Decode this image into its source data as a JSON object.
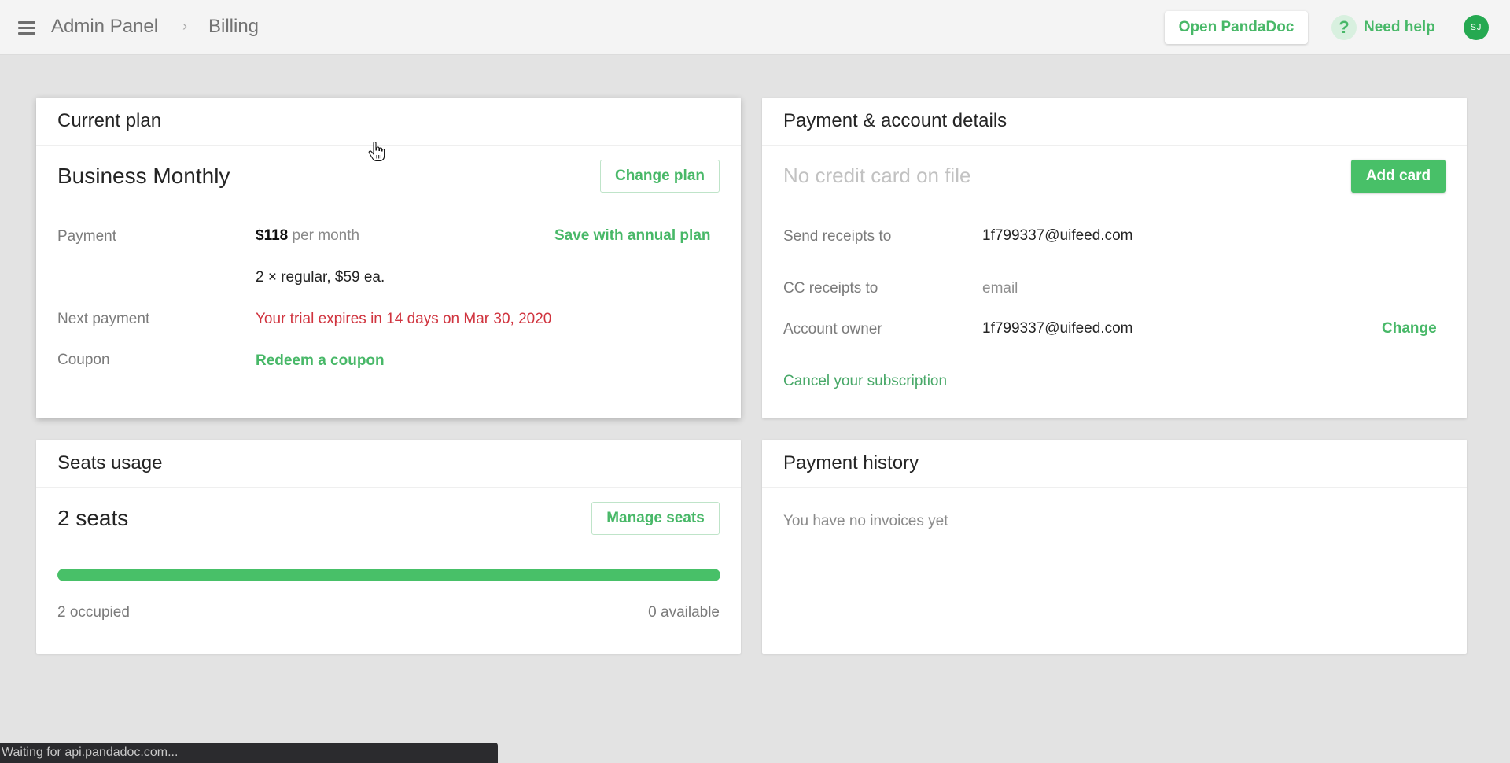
{
  "header": {
    "menu_icon": "hamburger-menu-icon",
    "breadcrumb": [
      "Admin Panel",
      "Billing"
    ],
    "breadcrumb_separator": "›",
    "open_app_label": "Open PandaDoc",
    "help_icon_glyph": "?",
    "help_label": "Need help",
    "avatar_initials": "SJ"
  },
  "current_plan": {
    "title": "Current plan",
    "plan_name": "Business Monthly",
    "change_plan_label": "Change plan",
    "payment_label": "Payment",
    "payment_amount": "$118",
    "payment_period": "per month",
    "save_annual_label": "Save with annual plan",
    "payment_breakdown": "2 × regular, $59 ea.",
    "next_payment_label": "Next payment",
    "next_payment_value": "Your trial expires in 14 days on Mar 30, 2020",
    "coupon_label": "Coupon",
    "redeem_label": "Redeem a coupon"
  },
  "account_details": {
    "title": "Payment & account details",
    "no_card_text": "No credit card on file",
    "add_card_label": "Add card",
    "send_receipts_label": "Send receipts to",
    "send_receipts_value": "1f799337@uifeed.com",
    "cc_receipts_label": "CC receipts to",
    "cc_receipts_placeholder": "email",
    "account_owner_label": "Account owner",
    "account_owner_value": "1f799337@uifeed.com",
    "change_owner_label": "Change",
    "cancel_label": "Cancel your subscription"
  },
  "seats": {
    "title": "Seats usage",
    "total": "2 seats",
    "manage_label": "Manage seats",
    "occupied_fraction": 1.0,
    "occupied_text": "2 occupied",
    "available_text": "0 available"
  },
  "payment_history": {
    "title": "Payment history",
    "empty_text": "You have no invoices yet"
  },
  "status_bar": {
    "text": "Waiting for api.pandadoc.com..."
  },
  "colors": {
    "accent_green": "#48c068",
    "link_green": "#48b868",
    "alert_red": "#d0343f",
    "avatar_green": "#25a951"
  }
}
